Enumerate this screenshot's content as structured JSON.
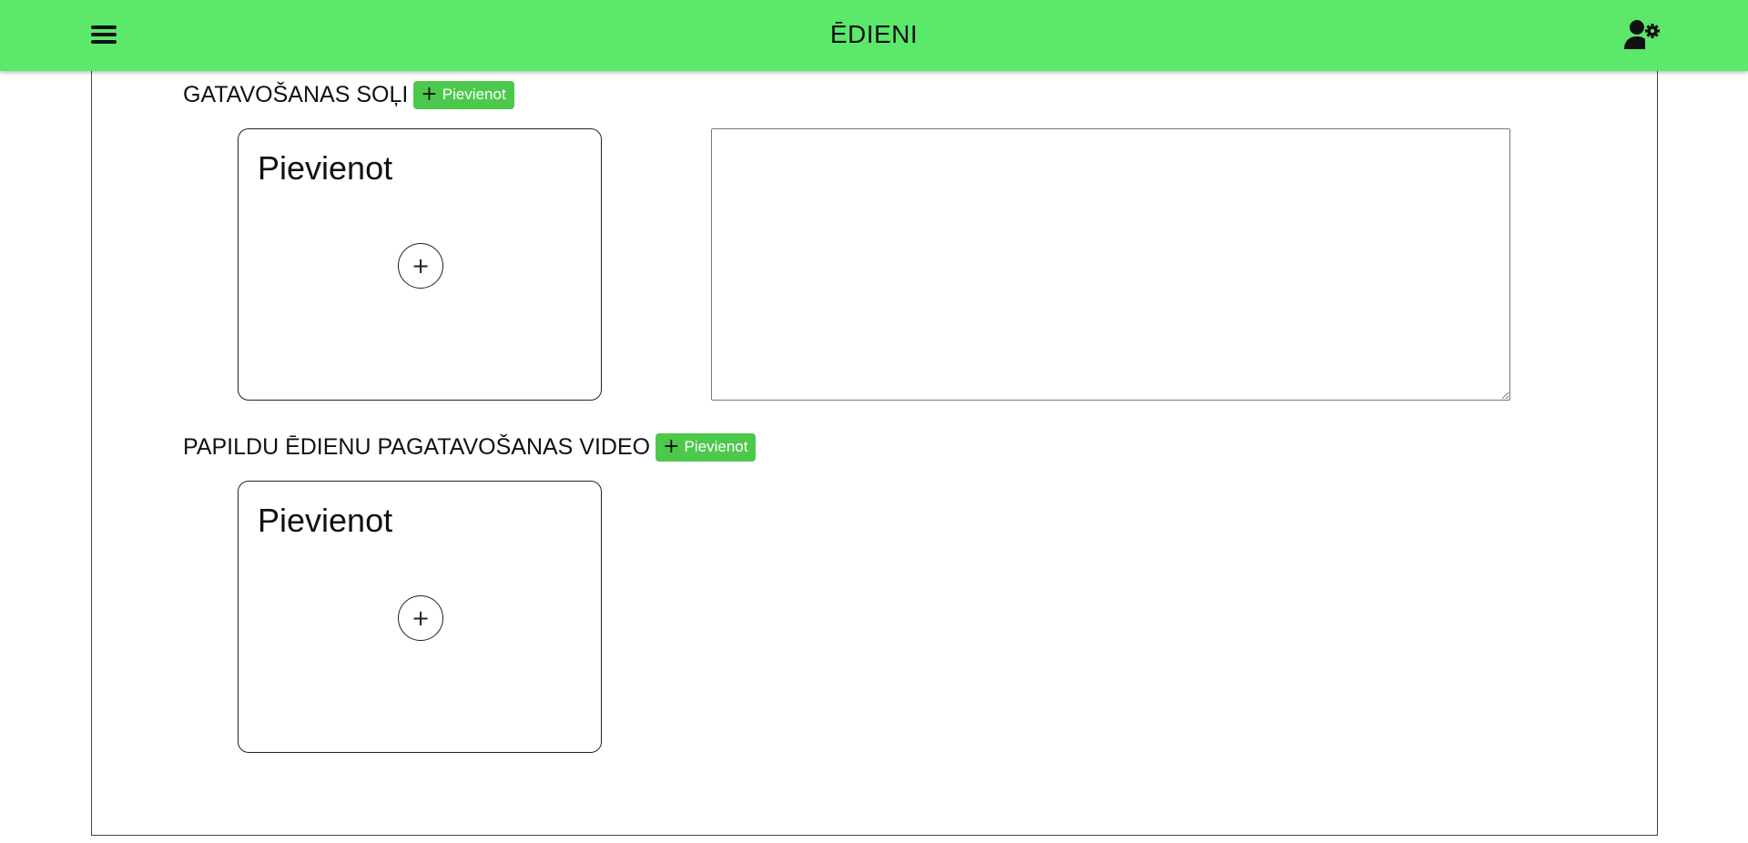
{
  "header": {
    "title": "ĒDIENI",
    "accent_color": "#5be86b",
    "menu_icon": "hamburger-menu-icon",
    "user_settings_icon": "user-gear-icon"
  },
  "sections": {
    "steps": {
      "title": "GATAVOŠANAS SOĻI",
      "add_button_label": "Pievienot",
      "card_label": "Pievienot",
      "textarea_value": ""
    },
    "videos": {
      "title": "PAPILDU ĒDIENU PAGATAVOŠANAS VIDEO",
      "add_button_label": "Pievienot",
      "card_label": "Pievienot"
    }
  },
  "colors": {
    "button_green": "#4cc94c"
  }
}
